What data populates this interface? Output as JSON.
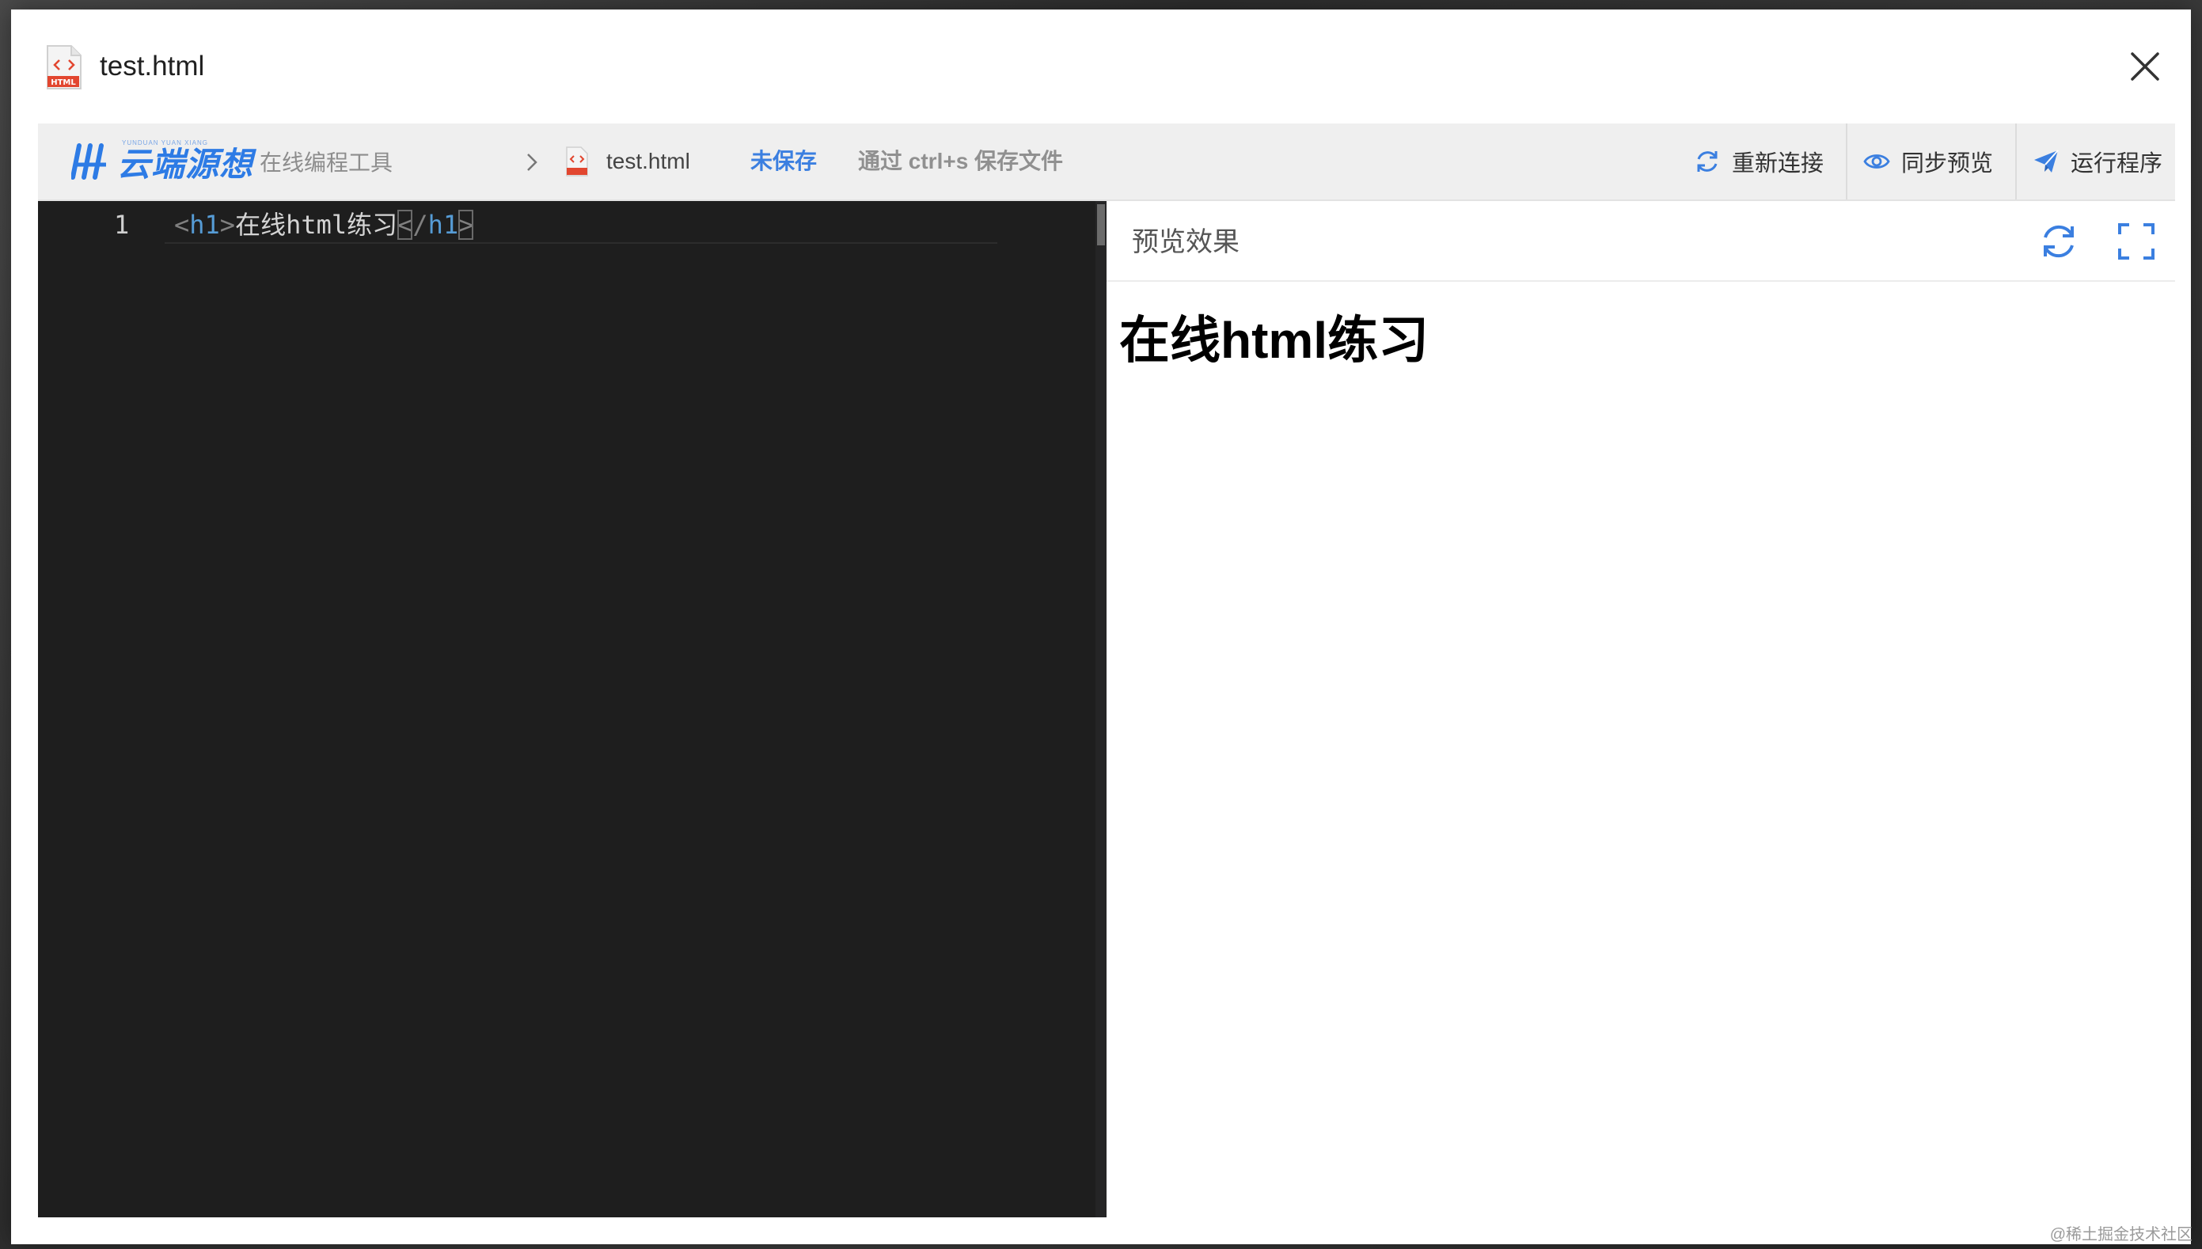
{
  "dialog": {
    "title": "test.html",
    "file_icon_label": "HTML"
  },
  "toolbar": {
    "logo_text": "云端源想",
    "logo_subtext": "YUNDUAN YUAN XIANG",
    "tool_name": "在线编程工具",
    "breadcrumb_file": "test.html",
    "status": "未保存",
    "save_hint": "通过 ctrl+s 保存文件",
    "buttons": {
      "reconnect": "重新连接",
      "sync_preview": "同步预览",
      "run": "运行程序"
    }
  },
  "editor": {
    "line_number": "1",
    "code": {
      "open_lt": "<",
      "open_tag": "h1",
      "open_gt": ">",
      "text": "在线html练习",
      "close_lt": "<",
      "close_slash": "/",
      "close_tag": "h1",
      "close_gt": ">"
    }
  },
  "preview": {
    "title": "预览效果",
    "content_h1": "在线html练习"
  },
  "watermark": "@稀土掘金技术社区",
  "colors": {
    "accent": "#3b7fe0",
    "editor_bg": "#1e1e1e",
    "toolbar_bg": "#efefef",
    "html_icon_red": "#e2462f"
  },
  "icons": {
    "file": "html-file-icon",
    "close": "close-icon",
    "chevron": "chevron-right-icon",
    "reconnect": "refresh-icon",
    "sync_preview": "eye-icon",
    "run": "paper-plane-icon",
    "preview_refresh": "refresh-icon",
    "fullscreen": "fullscreen-icon"
  }
}
